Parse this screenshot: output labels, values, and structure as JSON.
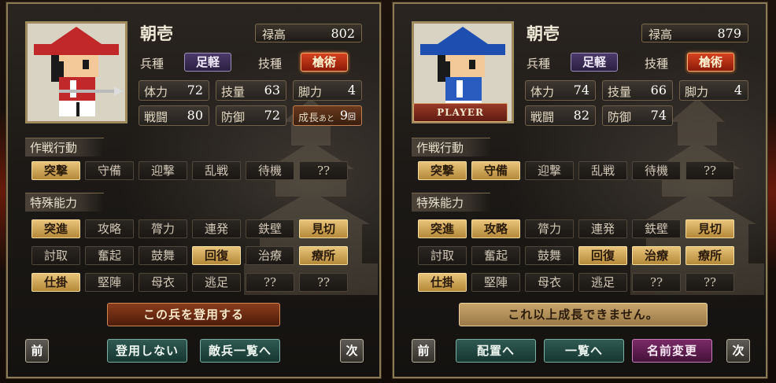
{
  "panels": [
    {
      "id": "left",
      "name": "朝壱",
      "player_banner": "",
      "stipend": {
        "label": "禄高",
        "value": "802"
      },
      "unit_type": {
        "label": "兵種",
        "value": "足軽"
      },
      "skill": {
        "label": "技種",
        "value": "槍術"
      },
      "stats": {
        "hp": {
          "label": "体力",
          "value": "72"
        },
        "tech": {
          "label": "技量",
          "value": "63"
        },
        "leg": {
          "label": "脚力",
          "value": "4"
        },
        "combat": {
          "label": "戦闘",
          "value": "80"
        },
        "defense": {
          "label": "防御",
          "value": "72"
        },
        "growth": {
          "label": "成長",
          "sub": "あと",
          "value": "9",
          "unit": "回"
        }
      },
      "tactics_title": "作戦行動",
      "tactics": [
        {
          "label": "突撃",
          "on": true
        },
        {
          "label": "守備",
          "on": false
        },
        {
          "label": "迎撃",
          "on": false
        },
        {
          "label": "乱戦",
          "on": false
        },
        {
          "label": "待機",
          "on": false
        },
        {
          "label": "??",
          "on": false
        }
      ],
      "abilities_title": "特殊能力",
      "abilities": [
        {
          "label": "突進",
          "on": true
        },
        {
          "label": "攻略",
          "on": false
        },
        {
          "label": "膂力",
          "on": false
        },
        {
          "label": "連発",
          "on": false
        },
        {
          "label": "鉄壁",
          "on": false
        },
        {
          "label": "見切",
          "on": true
        },
        {
          "label": "討取",
          "on": false
        },
        {
          "label": "奮起",
          "on": false
        },
        {
          "label": "鼓舞",
          "on": false
        },
        {
          "label": "回復",
          "on": true
        },
        {
          "label": "治療",
          "on": false
        },
        {
          "label": "療所",
          "on": true
        },
        {
          "label": "仕掛",
          "on": true
        },
        {
          "label": "堅陣",
          "on": false
        },
        {
          "label": "母衣",
          "on": false
        },
        {
          "label": "逃足",
          "on": false
        },
        {
          "label": "??",
          "on": false
        },
        {
          "label": "??",
          "on": false
        }
      ],
      "main_action": "この兵を登用する",
      "buttons": [
        "登用しない",
        "敵兵一覧へ"
      ],
      "prev": "前",
      "next": "次",
      "hat_color": "#c0282a",
      "shirt_color": "#c0282a"
    },
    {
      "id": "right",
      "name": "朝壱",
      "player_banner": "PLAYER",
      "stipend": {
        "label": "禄高",
        "value": "879"
      },
      "unit_type": {
        "label": "兵種",
        "value": "足軽"
      },
      "skill": {
        "label": "技種",
        "value": "槍術"
      },
      "stats": {
        "hp": {
          "label": "体力",
          "value": "74"
        },
        "tech": {
          "label": "技量",
          "value": "66"
        },
        "leg": {
          "label": "脚力",
          "value": "4"
        },
        "combat": {
          "label": "戦闘",
          "value": "82"
        },
        "defense": {
          "label": "防御",
          "value": "74"
        }
      },
      "tactics_title": "作戦行動",
      "tactics": [
        {
          "label": "突撃",
          "on": true
        },
        {
          "label": "守備",
          "on": true
        },
        {
          "label": "迎撃",
          "on": false
        },
        {
          "label": "乱戦",
          "on": false
        },
        {
          "label": "待機",
          "on": false
        },
        {
          "label": "??",
          "on": false
        }
      ],
      "abilities_title": "特殊能力",
      "abilities": [
        {
          "label": "突進",
          "on": true
        },
        {
          "label": "攻略",
          "on": true
        },
        {
          "label": "膂力",
          "on": false
        },
        {
          "label": "連発",
          "on": false
        },
        {
          "label": "鉄壁",
          "on": false
        },
        {
          "label": "見切",
          "on": true
        },
        {
          "label": "討取",
          "on": false
        },
        {
          "label": "奮起",
          "on": false
        },
        {
          "label": "鼓舞",
          "on": false
        },
        {
          "label": "回復",
          "on": true
        },
        {
          "label": "治療",
          "on": true
        },
        {
          "label": "療所",
          "on": true
        },
        {
          "label": "仕掛",
          "on": true
        },
        {
          "label": "堅陣",
          "on": false
        },
        {
          "label": "母衣",
          "on": false
        },
        {
          "label": "逃足",
          "on": false
        },
        {
          "label": "??",
          "on": false
        },
        {
          "label": "??",
          "on": false
        }
      ],
      "main_action": "これ以上成長できません。",
      "buttons": [
        "配置へ",
        "一覧へ",
        "名前変更"
      ],
      "prev": "前",
      "next": "次",
      "hat_color": "#1e4fb0",
      "shirt_color": "#2a5cc0"
    }
  ]
}
